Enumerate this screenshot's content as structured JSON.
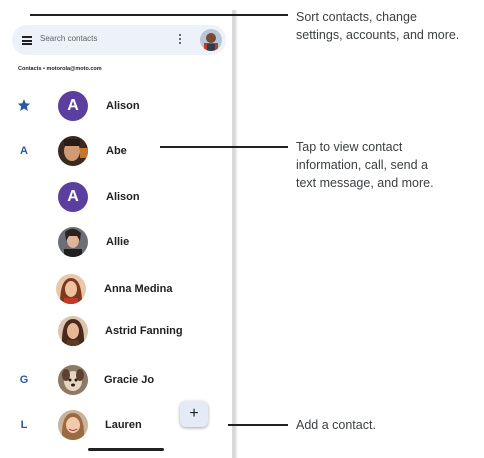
{
  "search": {
    "placeholder": "Search contacts"
  },
  "account": {
    "label": "Contacts • motorola@moto.com"
  },
  "contacts": [
    {
      "section": "★",
      "avatar_letter": "A",
      "name": "Alison",
      "starred": true
    },
    {
      "section": "A",
      "avatar_letter": "",
      "name": "Abe",
      "starred": false
    },
    {
      "section": "",
      "avatar_letter": "A",
      "name": "Alison",
      "starred": false
    },
    {
      "section": "",
      "avatar_letter": "",
      "name": "Allie",
      "starred": false
    },
    {
      "section": "",
      "avatar_letter": "",
      "name": "Anna Medina",
      "starred": false
    },
    {
      "section": "",
      "avatar_letter": "",
      "name": "Astrid Fanning",
      "starred": false
    },
    {
      "section": "G",
      "avatar_letter": "",
      "name": "Gracie Jo",
      "starred": false
    },
    {
      "section": "L",
      "avatar_letter": "",
      "name": "Lauren",
      "starred": false
    }
  ],
  "fab": {
    "label": "+"
  },
  "callouts": {
    "menu": "Sort contacts, change settings, accounts, and more.",
    "menu_line1": "Sort contacts, change",
    "menu_line2": "settings, accounts, and more.",
    "contact_line1": "Tap to view contact",
    "contact_line2": "information, call, send a",
    "contact_line3": "text message, and more.",
    "add": "Add a contact."
  },
  "colors": {
    "section_letter": "#2c5aa0",
    "avatar_letter_bg": "#5b3e9e",
    "search_bg": "#edf1f8",
    "fab_bg": "#e4ebf6"
  },
  "icons": {
    "menu": "hamburger-menu-icon",
    "more": "more-vertical-icon",
    "star": "star-icon",
    "add": "plus-icon"
  }
}
